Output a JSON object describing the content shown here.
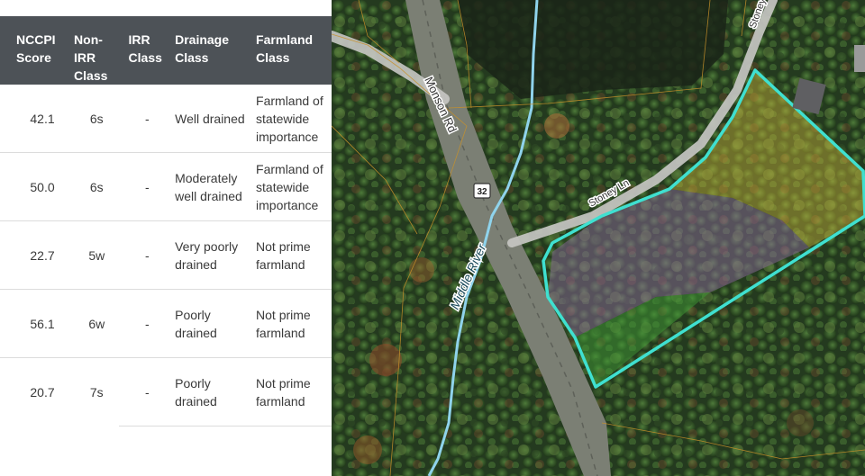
{
  "table": {
    "headers": [
      "NCCPI Score",
      "Non-IRR Class",
      "IRR Class",
      "Drainage Class",
      "Farmland Class"
    ],
    "rows": [
      {
        "nccpi": "42.1",
        "non_irr": "6s",
        "irr": "-",
        "drainage": "Well drained",
        "farmland": "Farmland of statewide importance"
      },
      {
        "nccpi": "50.0",
        "non_irr": "6s",
        "irr": "-",
        "drainage": "Moderately well drained",
        "farmland": "Farmland of statewide importance"
      },
      {
        "nccpi": "22.7",
        "non_irr": "5w",
        "irr": "-",
        "drainage": "Very poorly drained",
        "farmland": "Not prime farmland"
      },
      {
        "nccpi": "56.1",
        "non_irr": "6w",
        "irr": "-",
        "drainage": "Poorly drained",
        "farmland": "Not prime farmland"
      },
      {
        "nccpi": "20.7",
        "non_irr": "7s",
        "irr": "-",
        "drainage": "Poorly drained",
        "farmland": "Not prime farmland"
      }
    ]
  },
  "map": {
    "labels": {
      "monson_rd": "Monson Rd",
      "stoney_ln": "Stoney Ln",
      "middle_river": "Middle River",
      "route_shield": "32",
      "stoney_top": "Stoney"
    },
    "colors": {
      "parcel_outline": "#3fe0d0",
      "river": "#8fd3ec",
      "soil_yellow": "#c9b43a",
      "soil_purple": "#8a6a9a",
      "soil_green": "#3f9a35"
    }
  }
}
